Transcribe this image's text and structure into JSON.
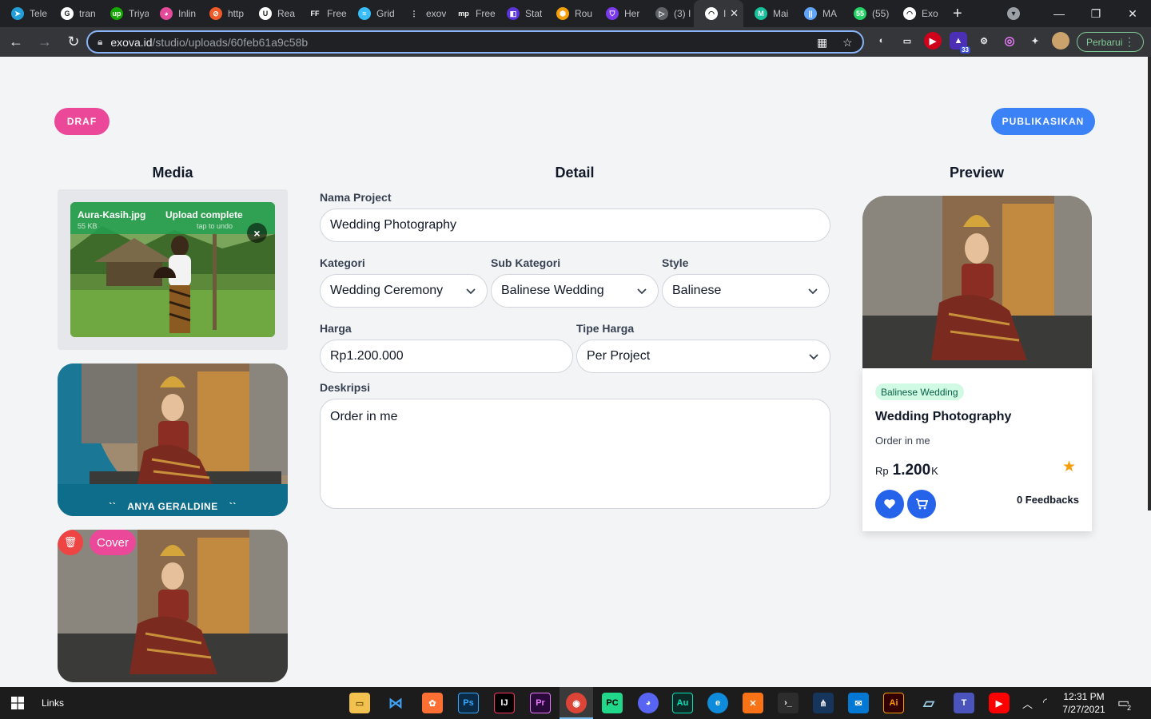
{
  "browser": {
    "tabs": [
      {
        "title": "Tele",
        "color": "#229ed9",
        "glyph": "➤"
      },
      {
        "title": "tran",
        "color": "#ffffff",
        "glyph": "G"
      },
      {
        "title": "Triya",
        "color": "#14a800",
        "glyph": "up"
      },
      {
        "title": "Inlin",
        "color": "#e34a9a",
        "glyph": "◕"
      },
      {
        "title": "http",
        "color": "#f05a28",
        "glyph": "⊘"
      },
      {
        "title": "Rea",
        "color": "#ffffff",
        "glyph": "U"
      },
      {
        "title": "Free",
        "color": "#202124",
        "glyph": "FF"
      },
      {
        "title": "Grid",
        "color": "#38bdf8",
        "glyph": "≈"
      },
      {
        "title": "exov",
        "color": "#202124",
        "glyph": "⋮"
      },
      {
        "title": "Free",
        "color": "#202124",
        "glyph": "mp"
      },
      {
        "title": "Stat",
        "color": "#5b34da",
        "glyph": "◧"
      },
      {
        "title": "Rou",
        "color": "#f59e0b",
        "glyph": "⬢"
      },
      {
        "title": "Her",
        "color": "#7c3aed",
        "glyph": "⛉"
      },
      {
        "title": "(3) I",
        "color": "#5f6368",
        "glyph": "▷"
      },
      {
        "title": "I",
        "color": "#ffffff",
        "glyph": "◠",
        "active": true
      },
      {
        "title": "Mai",
        "color": "#18c29c",
        "glyph": "M"
      },
      {
        "title": "MA",
        "color": "#60a5fa",
        "glyph": "||"
      },
      {
        "title": "(55)",
        "color": "#25d366",
        "glyph": "55"
      },
      {
        "title": "Exo",
        "color": "#ffffff",
        "glyph": "◠"
      }
    ],
    "new_tab": "+",
    "url_host": "exova.id",
    "url_path": "/studio/uploads/60feb61a9c58b",
    "update_label": "Perbarui",
    "ext_badge": "33"
  },
  "page": {
    "draft_label": "DRAF",
    "publish_label": "PUBLIKASIKAN",
    "media_title": "Media",
    "detail_title": "Detail",
    "preview_title": "Preview"
  },
  "upload": {
    "filename": "Aura-Kasih.jpg",
    "size": "55 KB",
    "status": "Upload complete",
    "undo": "tap to undo"
  },
  "media": {
    "card1_name": "ANYA GERALDINE",
    "cover_label": "Cover"
  },
  "form": {
    "name_label": "Nama Project",
    "name_value": "Wedding Photography",
    "category_label": "Kategori",
    "category_value": "Wedding Ceremony",
    "subcategory_label": "Sub Kategori",
    "subcategory_value": "Balinese Wedding",
    "style_label": "Style",
    "style_value": "Balinese",
    "price_label": "Harga",
    "price_value": "Rp1.200.000",
    "price_type_label": "Tipe Harga",
    "price_type_value": "Per Project",
    "desc_label": "Deskripsi",
    "desc_value": "Order in me"
  },
  "preview": {
    "badge": "Balinese Wedding",
    "title": "Wedding Photography",
    "desc": "Order in me",
    "currency": "Rp",
    "price": "1.200",
    "suffix": "K",
    "feedbacks": "0 Feedbacks"
  },
  "taskbar": {
    "links_label": "Links",
    "time": "12:31 PM",
    "date": "7/27/2021",
    "notif_count": "2"
  },
  "colors": {
    "pink": "#ec4899",
    "blue": "#3b82f6",
    "accent_blue": "#2563eb",
    "star": "#f59e0b"
  }
}
